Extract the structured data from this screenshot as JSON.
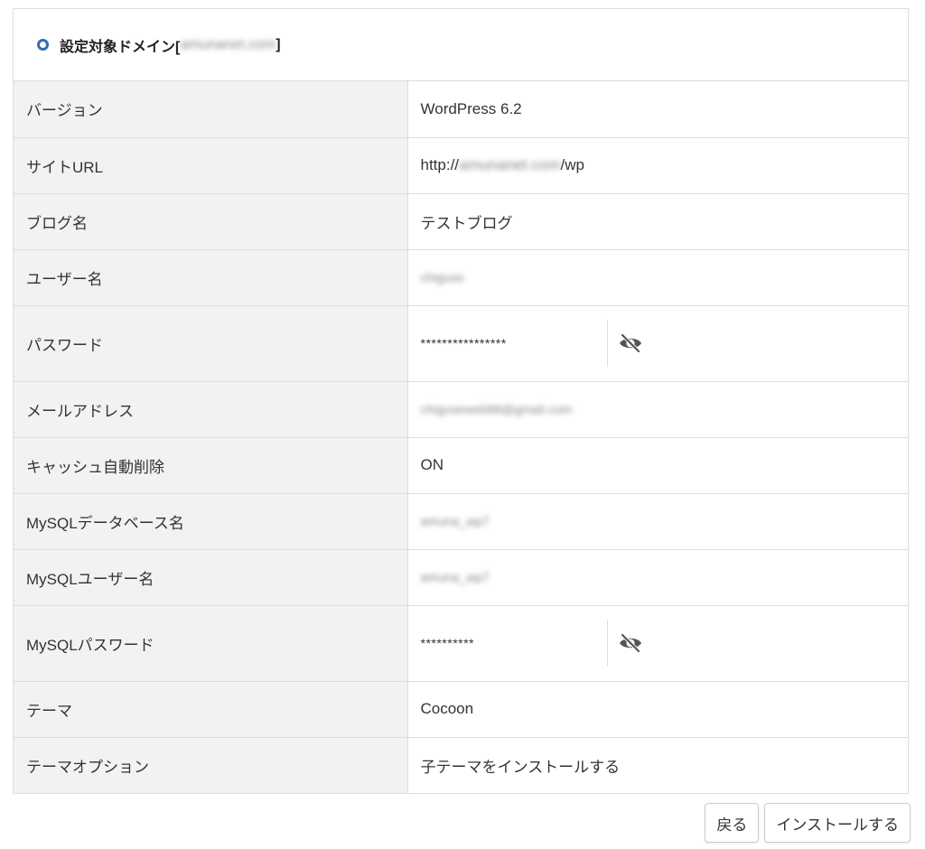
{
  "header": {
    "title_prefix": "設定対象ドメイン[",
    "domain_blurred": "amunanet.com",
    "title_suffix": "]"
  },
  "rows": [
    {
      "label": "バージョン",
      "value": "WordPress 6.2"
    },
    {
      "label": "サイトURL",
      "value_prefix": "http://",
      "value_blurred": "amunanet.com",
      "value_suffix": "/wp"
    },
    {
      "label": "ブログ名",
      "value": "テストブログ"
    },
    {
      "label": "ユーザー名",
      "value_blurred": "chiguse"
    },
    {
      "label": "パスワード",
      "value": "****************",
      "toggle_icon": "eye-slash-icon"
    },
    {
      "label": "メールアドレス",
      "value_blurred": "chiguseweb88@gmail.com"
    },
    {
      "label": "キャッシュ自動削除",
      "value": "ON"
    },
    {
      "label": "MySQLデータベース名",
      "value_blurred": "amuna_wp7"
    },
    {
      "label": "MySQLユーザー名",
      "value_blurred": "amuna_wp7"
    },
    {
      "label": "MySQLパスワード",
      "value": "**********",
      "toggle_icon": "eye-slash-icon"
    },
    {
      "label": "テーマ",
      "value": "Cocoon"
    },
    {
      "label": "テーマオプション",
      "value": "子テーマをインストールする"
    }
  ],
  "buttons": {
    "back_label": "戻る",
    "install_label": "インストールする"
  },
  "colors": {
    "accent": "#2f6eb5",
    "label_bg": "#f2f2f2",
    "border": "#dddddd"
  }
}
